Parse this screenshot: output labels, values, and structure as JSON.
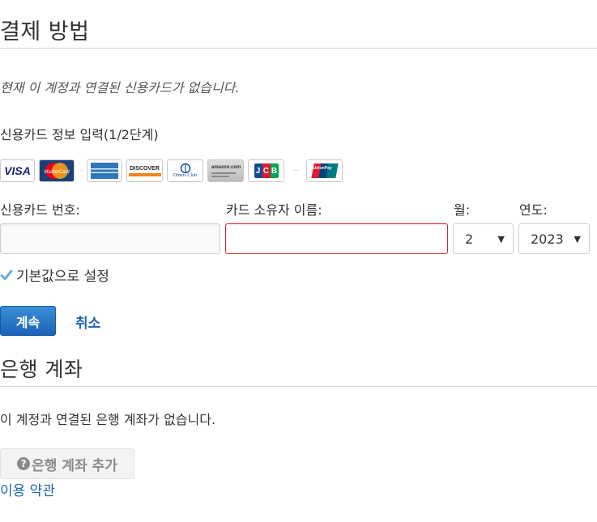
{
  "payment_section": {
    "title": "결제 방법",
    "notice": "현재 이 계정과 연결된 신용카드가 없습니다.",
    "step_label": "신용카드 정보 입력(1/2단계)",
    "cards": [
      {
        "icon": "visa-card-icon",
        "text": "VISA",
        "color": "#1a1f71"
      },
      {
        "icon": "mastercard-icon",
        "text": "MasterCard",
        "color": "#eb001b"
      },
      {
        "icon": "amex-card-icon",
        "text": "",
        "color": "#2e77bb"
      },
      {
        "icon": "discover-card-icon",
        "text": "DISCOVER",
        "color": "#f58220"
      },
      {
        "icon": "diners-club-card-icon",
        "text": "Diners Club",
        "color": "#0c4c8a"
      },
      {
        "icon": "amazon-card-icon",
        "text": "amazon.com",
        "color": "#555555"
      },
      {
        "icon": "jcb-card-icon",
        "text": "JCB",
        "color": "#0e4c96"
      },
      {
        "icon": "unionpay-card-icon",
        "text": "UnionPay",
        "color": "#e21836"
      }
    ],
    "labels": {
      "card_number": "신용카드 번호:",
      "card_holder": "카드 소유자 이름:",
      "month": "월:",
      "year": "연도:"
    },
    "inputs": {
      "card_number_value": "",
      "card_holder_value": "",
      "month_value": "2",
      "year_value": "2023"
    },
    "default_label": "기본값으로 설정",
    "default_checked": true,
    "continue_label": "계속",
    "cancel_label": "취소"
  },
  "bank_section": {
    "title": "은행 계좌",
    "notice": "이 계정과 연결된 은행 계좌가 없습니다.",
    "add_button_label": "은행 계좌 추가",
    "help_icon": "?",
    "terms_link": "이용 약관"
  },
  "colors": {
    "accent": "#1e65b5",
    "error_border": "#d0282c",
    "check": "#6aa9d8"
  }
}
